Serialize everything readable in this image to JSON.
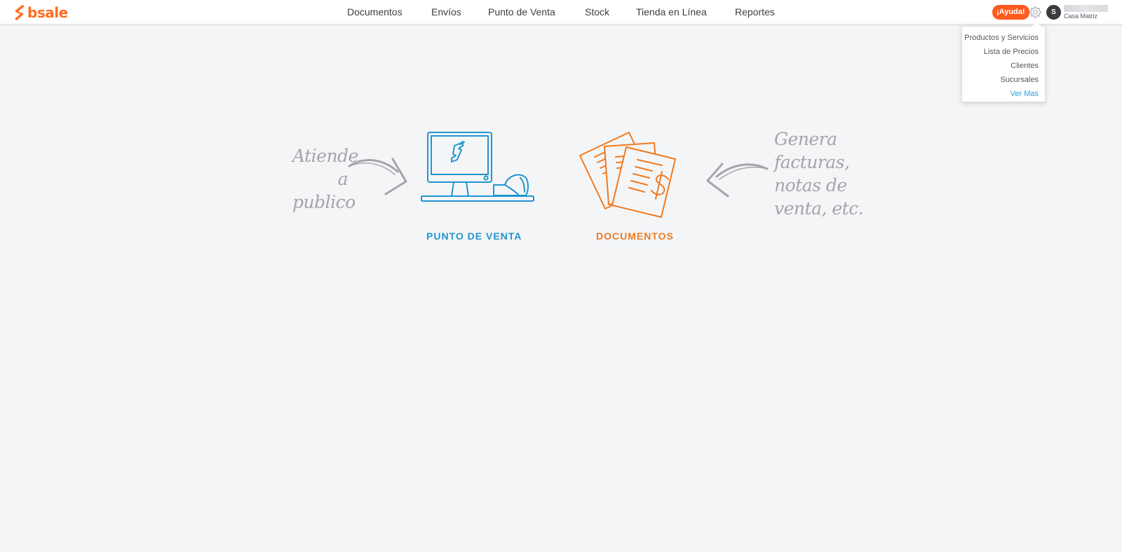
{
  "brand": {
    "name": "bsale",
    "color": "#ff6d1f"
  },
  "nav": {
    "items": [
      {
        "label": "Documentos"
      },
      {
        "label": "Envíos"
      },
      {
        "label": "Punto de Venta"
      },
      {
        "label": "Stock"
      },
      {
        "label": "Tienda en Línea"
      },
      {
        "label": "Reportes"
      }
    ]
  },
  "header_right": {
    "help_label": "¡Ayuda!",
    "settings_icon": "gear-icon",
    "avatar_initial": "S",
    "branch_label": "Casa Matriz"
  },
  "settings_menu": {
    "items": [
      {
        "label": "Productos y Servicios"
      },
      {
        "label": "Lista de Precios"
      },
      {
        "label": "Clientes"
      },
      {
        "label": "Sucursales"
      },
      {
        "label": "Ver Mas"
      }
    ]
  },
  "main": {
    "left_note": [
      "Atiende",
      "a",
      "publico"
    ],
    "right_note": [
      "Genera",
      "facturas,",
      "notas de",
      "venta, etc."
    ],
    "pos": {
      "label": "PUNTO DE VENTA",
      "color": "#1f95cf",
      "icon": "pos-terminal-icon"
    },
    "documents": {
      "label": "DOCUMENTOS",
      "color": "#f07a1e",
      "icon": "documents-icon"
    }
  },
  "colors": {
    "page_bg": "#f4f5f7",
    "help_bg": "#ff5a1f",
    "link": "#2a9fd6",
    "note_text": "#a3a5a8"
  }
}
